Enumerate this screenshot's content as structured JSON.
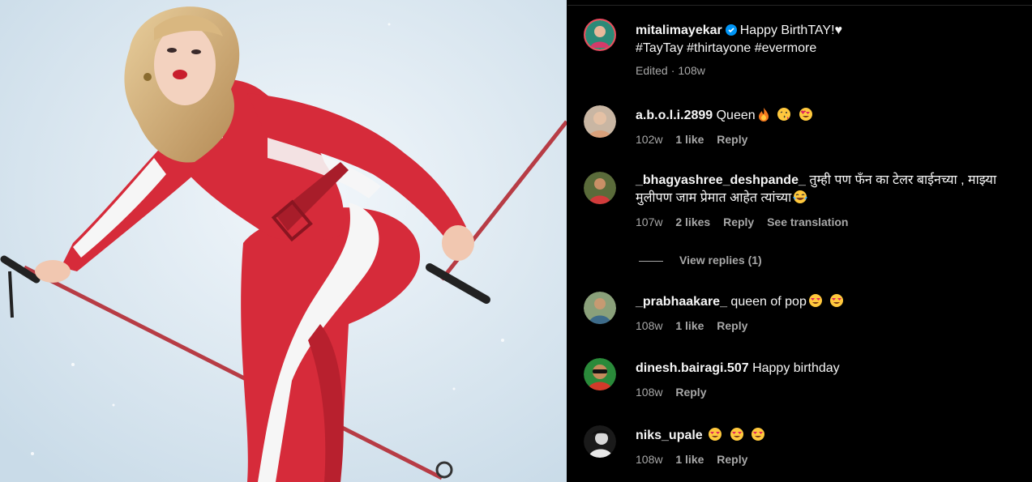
{
  "post": {
    "author": "mitalimayekar",
    "caption_line1": "Happy BirthTAY!♥",
    "caption_line2": "#TayTay #thirtayone #evermore",
    "edited": "Edited",
    "time": "108w"
  },
  "comments": [
    {
      "user": "a.b.o.l.i.2899",
      "text": "Queen",
      "emojis": [
        "fire",
        "kiss",
        "heart-eyes"
      ],
      "time": "102w",
      "likes": "1 like",
      "reply": "Reply"
    },
    {
      "user": "_bhagyashree_deshpande_",
      "text": "तुम्ही पण फँन का टेलर बाईनच्या , माझ्या मुलीपण जाम प्रेमात आहेत त्यांच्या",
      "emojis": [
        "laugh"
      ],
      "time": "107w",
      "likes": "2 likes",
      "reply": "Reply",
      "translate": "See translation"
    },
    {
      "user": "_prabhaakare_",
      "text": "queen of pop",
      "emojis": [
        "heart-eyes",
        "heart-eyes"
      ],
      "time": "108w",
      "likes": "1 like",
      "reply": "Reply"
    },
    {
      "user": "dinesh.bairagi.507",
      "text": "Happy birthday",
      "emojis": [],
      "time": "108w",
      "likes": "",
      "reply": "Reply"
    },
    {
      "user": "niks_upale",
      "text": "",
      "emojis": [
        "heart-eyes",
        "heart-eyes",
        "heart-eyes"
      ],
      "time": "108w",
      "likes": "1 like",
      "reply": "Reply"
    }
  ],
  "view_replies": "View replies (1)",
  "colors": {
    "background": "#000000",
    "text": "#f5f5f5",
    "muted": "#a8a8a8",
    "verified": "#0095f6",
    "suit_red": "#d62b3a",
    "snow": "#dbe8f1"
  }
}
